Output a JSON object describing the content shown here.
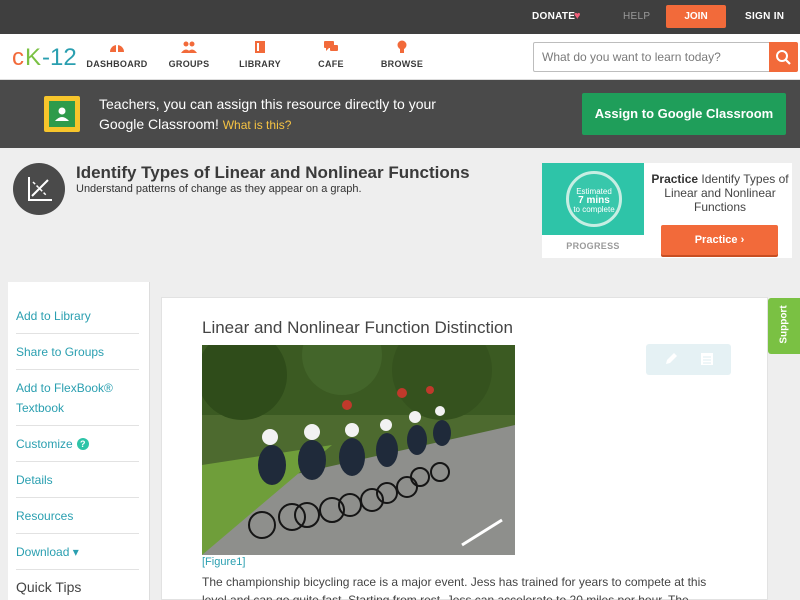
{
  "topbar": {
    "donate": "DONATE",
    "help": "HELP",
    "join": "JOIN",
    "signin": "SIGN IN"
  },
  "brand": {
    "logo_text": "cK-12"
  },
  "nav": {
    "items": [
      {
        "label": "DASHBOARD",
        "icon": "dashboard-gauge-icon"
      },
      {
        "label": "GROUPS",
        "icon": "groups-people-icon"
      },
      {
        "label": "LIBRARY",
        "icon": "library-book-icon"
      },
      {
        "label": "CAFE",
        "icon": "cafe-chat-icon"
      },
      {
        "label": "BROWSE",
        "icon": "browse-bulb-icon"
      }
    ],
    "search_placeholder": "What do you want to learn today?"
  },
  "banner": {
    "text": "Teachers, you can assign this resource directly to your Google Classroom!",
    "what_link": "What is this?",
    "assign_button": "Assign to Google Classroom"
  },
  "concept": {
    "title": "Identify Types of Linear and Nonlinear Functions",
    "subtitle": "Understand patterns of change as they appear on a graph."
  },
  "practice": {
    "estimated_line1": "Estimated",
    "estimated_line2": "7 mins",
    "estimated_line3": "to complete",
    "progress_label": "PROGRESS",
    "practice_bold": "Practice",
    "practice_rest": " Identify Types of Linear and Nonlinear Functions",
    "button": "Practice"
  },
  "sidebar": {
    "items": [
      "Add to Library",
      "Share to Groups",
      "Add to FlexBook® Textbook",
      "Customize",
      "Details",
      "Resources",
      "Download ▾"
    ],
    "customize_badge": "?",
    "quick_tips": "Quick Tips"
  },
  "content": {
    "section_title": "Linear and Nonlinear Function Distinction",
    "figure_caption": "[Figure1]",
    "paragraph": "The championship bicycling race is a major event. Jess has trained for years to compete at this level and can go quite fast. Starting from rest, Jess can accelerate to 20 miles per hour. The"
  },
  "support": {
    "label": "Support"
  },
  "colors": {
    "accent_orange": "#f26a3a",
    "banner_green": "#1f9e5a",
    "link_teal": "#2a9fb0",
    "progress_teal": "#2ec4a8",
    "support_green": "#7ac143"
  }
}
